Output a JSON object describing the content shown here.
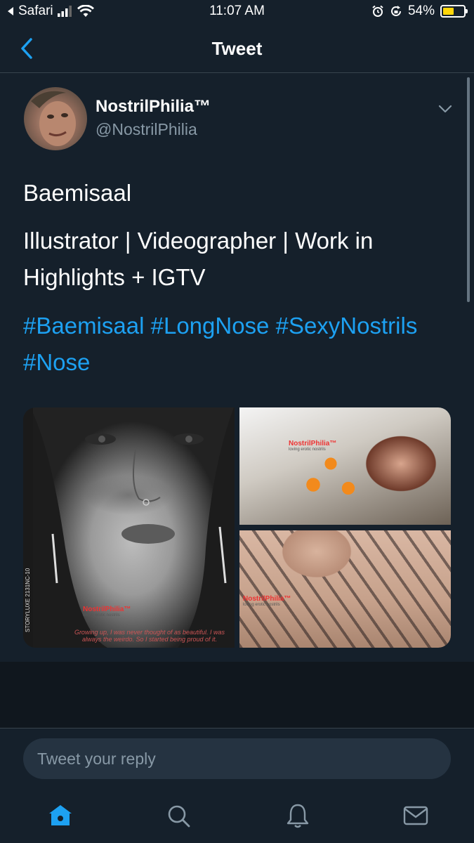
{
  "status_bar": {
    "carrier": "Safari",
    "time": "11:07 AM",
    "battery_percent": "54%",
    "battery_level": 0.54,
    "battery_color": "#ffd60a"
  },
  "nav": {
    "title": "Tweet"
  },
  "tweet": {
    "display_name": "NostrilPhilia™",
    "handle": "@NostrilPhilia",
    "line1": "Baemisaal",
    "line2": "Illustrator | Videographer | Work in Highlights + IGTV",
    "hashtags": [
      "#Baemisaal",
      "#LongNose",
      "#SexyNostrils",
      "#Nose"
    ],
    "media": {
      "watermark": "NostrilPhilia™",
      "watermark_sub": "loving erotic nostrils",
      "side_strip": "STORYLUXE  2131NC-10",
      "quote": "Growing up, I was never thought of as beautiful. I was always the weirdo. So I started being proud of it."
    }
  },
  "reply": {
    "placeholder": "Tweet your reply"
  },
  "tab_bar": {
    "items": [
      "home-icon",
      "search-icon",
      "notifications-icon",
      "messages-icon"
    ],
    "active_color": "#1da1f2",
    "inactive_color": "#8899a6"
  },
  "colors": {
    "background": "#15202b",
    "accent": "#1da1f2",
    "secondary_text": "#8899a6"
  }
}
